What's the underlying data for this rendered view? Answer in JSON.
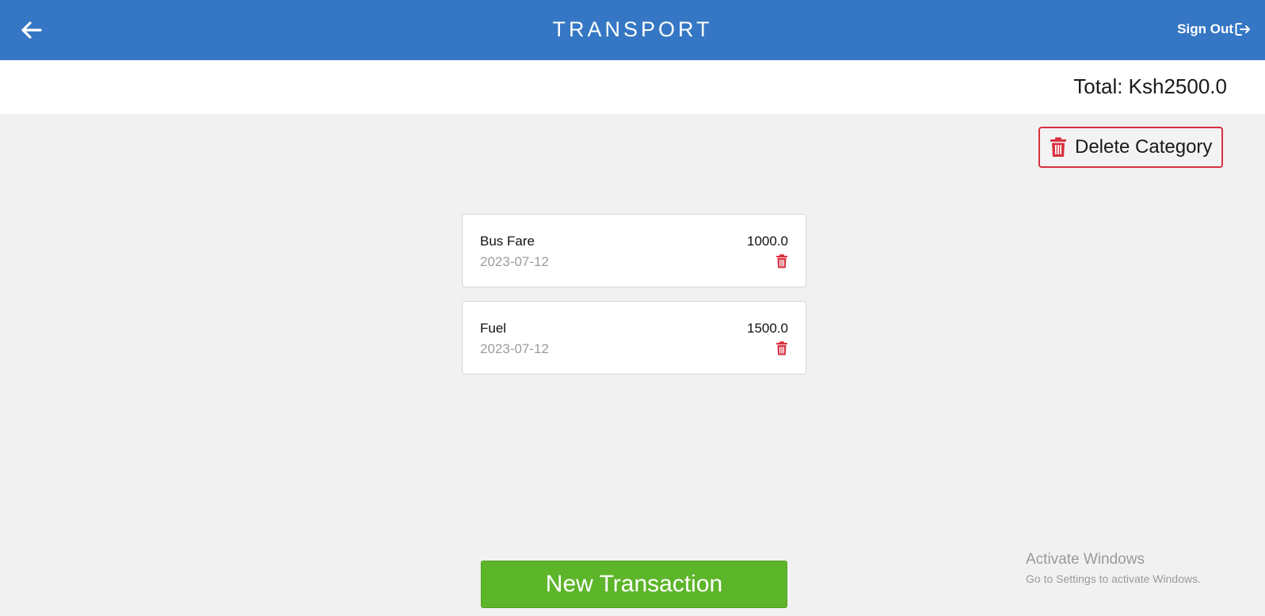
{
  "header": {
    "title": "TRANSPORT",
    "back_icon": "arrow-left-icon",
    "signout_label": "Sign Out",
    "signout_icon": "sign-out-icon"
  },
  "summary": {
    "total": "Total: Ksh2500.0"
  },
  "actions": {
    "delete_category_label": "Delete Category",
    "delete_icon": "trash-icon",
    "new_transaction_label": "New Transaction"
  },
  "transactions": [
    {
      "name": "Bus Fare",
      "amount": "1000.0",
      "date": "2023-07-12"
    },
    {
      "name": "Fuel",
      "amount": "1500.0",
      "date": "2023-07-12"
    }
  ],
  "watermark": {
    "line1": "Activate Windows",
    "line2": "Go to Settings to activate Windows."
  },
  "colors": {
    "header_bg": "#3577c4",
    "danger": "#d8313f",
    "success": "#5db52a",
    "page_bg": "#f0f1f0"
  }
}
